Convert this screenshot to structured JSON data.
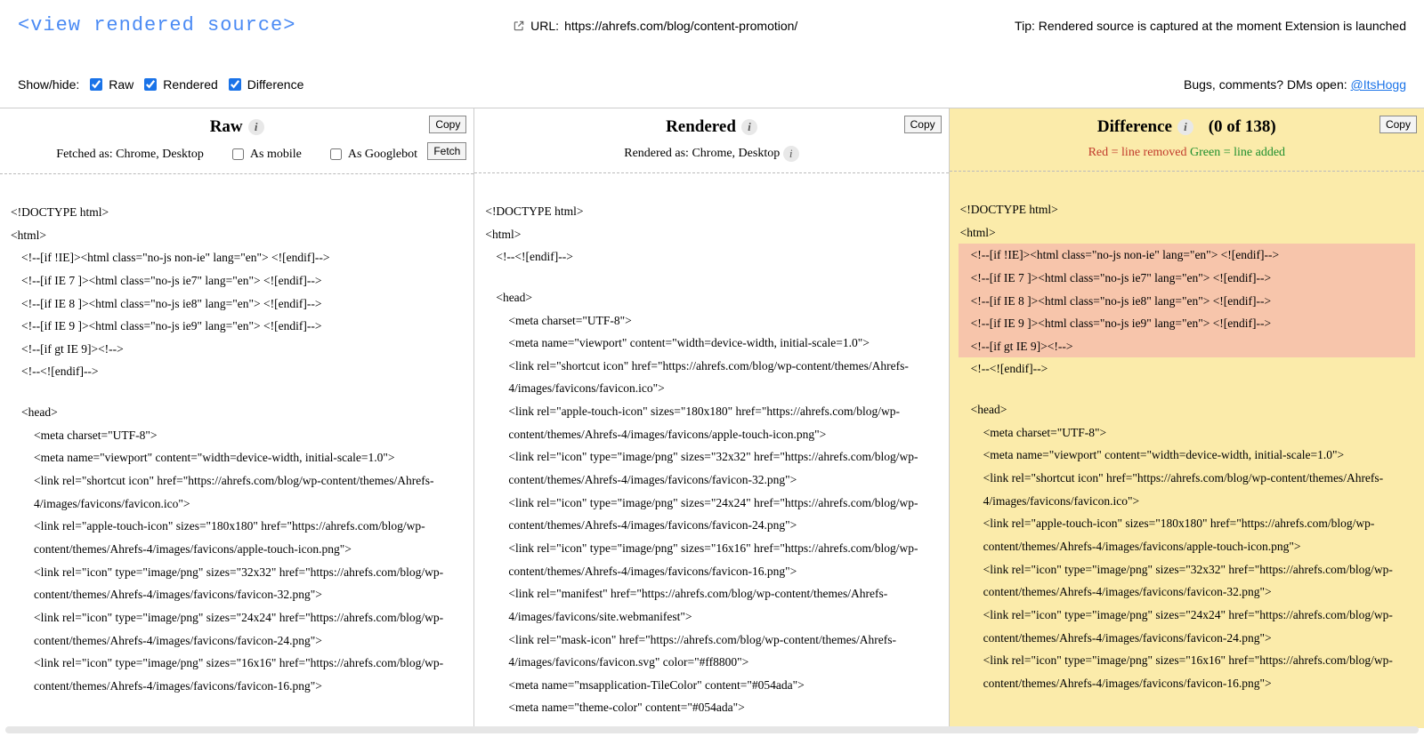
{
  "header": {
    "app_title": "<view rendered source>",
    "url_label": "URL:",
    "url_value": "https://ahrefs.com/blog/content-promotion/",
    "tip": "Tip: Rendered source is captured at the moment Extension is launched"
  },
  "toolbar": {
    "show_hide_label": "Show/hide:",
    "raw_label": "Raw",
    "rendered_label": "Rendered",
    "difference_label": "Difference",
    "feedback_prefix": "Bugs, comments? DMs open: ",
    "feedback_handle": "@ItsHogg"
  },
  "columns": {
    "raw": {
      "title": "Raw",
      "copy_label": "Copy",
      "fetched_as": "Fetched as: Chrome, Desktop",
      "as_mobile_label": "As mobile",
      "as_googlebot_label": "As Googlebot",
      "fetch_label": "Fetch",
      "lines": [
        {
          "t": "<!DOCTYPE html>",
          "ind": 0
        },
        {
          "t": "<html>",
          "ind": 0
        },
        {
          "t": "<!--[if !IE]><html class=\"no-js non-ie\" lang=\"en\"> <![endif]-->",
          "ind": 1
        },
        {
          "t": "<!--[if IE 7 ]><html class=\"no-js ie7\" lang=\"en\"> <![endif]-->",
          "ind": 1
        },
        {
          "t": "<!--[if IE 8 ]><html class=\"no-js ie8\" lang=\"en\"> <![endif]-->",
          "ind": 1
        },
        {
          "t": "<!--[if IE 9 ]><html class=\"no-js ie9\" lang=\"en\"> <![endif]-->",
          "ind": 1
        },
        {
          "t": "<!--[if gt IE 9]><!-->",
          "ind": 1
        },
        {
          "t": "<!--<![endif]-->",
          "ind": 1
        },
        {
          "t": "",
          "ind": 0
        },
        {
          "t": "<head>",
          "ind": 1
        },
        {
          "t": "<meta charset=\"UTF-8\">",
          "ind": 2
        },
        {
          "t": "<meta name=\"viewport\" content=\"width=device-width, initial-scale=1.0\">",
          "ind": 2
        },
        {
          "t": "<link rel=\"shortcut icon\" href=\"https://ahrefs.com/blog/wp-content/themes/Ahrefs-4/images/favicons/favicon.ico\">",
          "ind": 2
        },
        {
          "t": "<link rel=\"apple-touch-icon\" sizes=\"180x180\" href=\"https://ahrefs.com/blog/wp-content/themes/Ahrefs-4/images/favicons/apple-touch-icon.png\">",
          "ind": 2
        },
        {
          "t": "<link rel=\"icon\" type=\"image/png\" sizes=\"32x32\" href=\"https://ahrefs.com/blog/wp-content/themes/Ahrefs-4/images/favicons/favicon-32.png\">",
          "ind": 2
        },
        {
          "t": "<link rel=\"icon\" type=\"image/png\" sizes=\"24x24\" href=\"https://ahrefs.com/blog/wp-content/themes/Ahrefs-4/images/favicons/favicon-24.png\">",
          "ind": 2
        },
        {
          "t": "<link rel=\"icon\" type=\"image/png\" sizes=\"16x16\" href=\"https://ahrefs.com/blog/wp-content/themes/Ahrefs-4/images/favicons/favicon-16.png\">",
          "ind": 2
        }
      ]
    },
    "rendered": {
      "title": "Rendered",
      "copy_label": "Copy",
      "rendered_as": "Rendered as: Chrome, Desktop",
      "lines": [
        {
          "t": "<!DOCTYPE html>",
          "ind": 0
        },
        {
          "t": "<html>",
          "ind": 0
        },
        {
          "t": "<!--<![endif]-->",
          "ind": 1
        },
        {
          "t": "",
          "ind": 0
        },
        {
          "t": "<head>",
          "ind": 1
        },
        {
          "t": "<meta charset=\"UTF-8\">",
          "ind": 2
        },
        {
          "t": "<meta name=\"viewport\" content=\"width=device-width, initial-scale=1.0\">",
          "ind": 2
        },
        {
          "t": "<link rel=\"shortcut icon\" href=\"https://ahrefs.com/blog/wp-content/themes/Ahrefs-4/images/favicons/favicon.ico\">",
          "ind": 2
        },
        {
          "t": "<link rel=\"apple-touch-icon\" sizes=\"180x180\" href=\"https://ahrefs.com/blog/wp-content/themes/Ahrefs-4/images/favicons/apple-touch-icon.png\">",
          "ind": 2
        },
        {
          "t": "<link rel=\"icon\" type=\"image/png\" sizes=\"32x32\" href=\"https://ahrefs.com/blog/wp-content/themes/Ahrefs-4/images/favicons/favicon-32.png\">",
          "ind": 2
        },
        {
          "t": "<link rel=\"icon\" type=\"image/png\" sizes=\"24x24\" href=\"https://ahrefs.com/blog/wp-content/themes/Ahrefs-4/images/favicons/favicon-24.png\">",
          "ind": 2
        },
        {
          "t": "<link rel=\"icon\" type=\"image/png\" sizes=\"16x16\" href=\"https://ahrefs.com/blog/wp-content/themes/Ahrefs-4/images/favicons/favicon-16.png\">",
          "ind": 2
        },
        {
          "t": "<link rel=\"manifest\" href=\"https://ahrefs.com/blog/wp-content/themes/Ahrefs-4/images/favicons/site.webmanifest\">",
          "ind": 2
        },
        {
          "t": "<link rel=\"mask-icon\" href=\"https://ahrefs.com/blog/wp-content/themes/Ahrefs-4/images/favicons/favicon.svg\" color=\"#ff8800\">",
          "ind": 2
        },
        {
          "t": "<meta name=\"msapplication-TileColor\" content=\"#054ada\">",
          "ind": 2
        },
        {
          "t": "<meta name=\"theme-color\" content=\"#054ada\">",
          "ind": 2
        }
      ]
    },
    "difference": {
      "title": "Difference",
      "counter": "(0 of 138)",
      "copy_label": "Copy",
      "legend_removed": "Red = line removed",
      "legend_added": "Green = line added",
      "lines": [
        {
          "t": "<!DOCTYPE html>",
          "ind": 0,
          "cls": ""
        },
        {
          "t": "<html>",
          "ind": 0,
          "cls": ""
        },
        {
          "t": "<!--[if !IE]><html class=\"no-js non-ie\" lang=\"en\"> <![endif]-->",
          "ind": 1,
          "cls": "removed-line"
        },
        {
          "t": "<!--[if IE 7 ]><html class=\"no-js ie7\" lang=\"en\"> <![endif]-->",
          "ind": 1,
          "cls": "removed-line"
        },
        {
          "t": "<!--[if IE 8 ]><html class=\"no-js ie8\" lang=\"en\"> <![endif]-->",
          "ind": 1,
          "cls": "removed-line"
        },
        {
          "t": "<!--[if IE 9 ]><html class=\"no-js ie9\" lang=\"en\"> <![endif]-->",
          "ind": 1,
          "cls": "removed-line"
        },
        {
          "t": "<!--[if gt IE 9]><!-->",
          "ind": 1,
          "cls": "removed-line"
        },
        {
          "t": "<!--<![endif]-->",
          "ind": 1,
          "cls": ""
        },
        {
          "t": "",
          "ind": 0,
          "cls": ""
        },
        {
          "t": "<head>",
          "ind": 1,
          "cls": ""
        },
        {
          "t": "<meta charset=\"UTF-8\">",
          "ind": 2,
          "cls": ""
        },
        {
          "t": "<meta name=\"viewport\" content=\"width=device-width, initial-scale=1.0\">",
          "ind": 2,
          "cls": ""
        },
        {
          "t": "<link rel=\"shortcut icon\" href=\"https://ahrefs.com/blog/wp-content/themes/Ahrefs-4/images/favicons/favicon.ico\">",
          "ind": 2,
          "cls": ""
        },
        {
          "t": "<link rel=\"apple-touch-icon\" sizes=\"180x180\" href=\"https://ahrefs.com/blog/wp-content/themes/Ahrefs-4/images/favicons/apple-touch-icon.png\">",
          "ind": 2,
          "cls": ""
        },
        {
          "t": "<link rel=\"icon\" type=\"image/png\" sizes=\"32x32\" href=\"https://ahrefs.com/blog/wp-content/themes/Ahrefs-4/images/favicons/favicon-32.png\">",
          "ind": 2,
          "cls": ""
        },
        {
          "t": "<link rel=\"icon\" type=\"image/png\" sizes=\"24x24\" href=\"https://ahrefs.com/blog/wp-content/themes/Ahrefs-4/images/favicons/favicon-24.png\">",
          "ind": 2,
          "cls": ""
        },
        {
          "t": "<link rel=\"icon\" type=\"image/png\" sizes=\"16x16\" href=\"https://ahrefs.com/blog/wp-content/themes/Ahrefs-4/images/favicons/favicon-16.png\">",
          "ind": 2,
          "cls": ""
        }
      ]
    }
  }
}
